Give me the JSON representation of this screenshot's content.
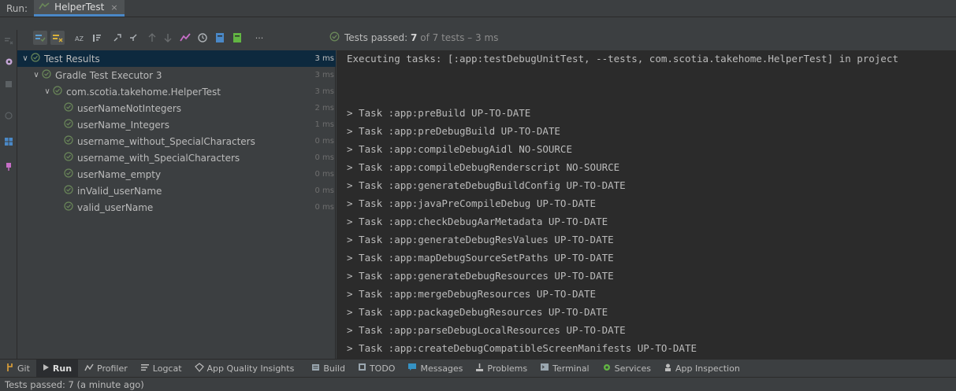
{
  "header": {
    "run_label": "Run:",
    "tab_title": "HelperTest",
    "tab_close": "×"
  },
  "toolbar": {
    "status_prefix": "Tests passed:",
    "status_count": "7",
    "status_suffix": "of 7 tests – 3 ms",
    "more": "···"
  },
  "tree": {
    "root": {
      "label": "Test Results",
      "time": "3 ms"
    },
    "executor": {
      "label": "Gradle Test Executor 3",
      "time": "3 ms"
    },
    "class": {
      "label": "com.scotia.takehome.HelperTest",
      "time": "3 ms"
    },
    "tests": [
      {
        "label": "userNameNotIntegers",
        "time": "2 ms"
      },
      {
        "label": "userName_Integers",
        "time": "1 ms"
      },
      {
        "label": "username_without_SpecialCharacters",
        "time": "0 ms"
      },
      {
        "label": "username_with_SpecialCharacters",
        "time": "0 ms"
      },
      {
        "label": "userName_empty",
        "time": "0 ms"
      },
      {
        "label": "inValid_userName",
        "time": "0 ms"
      },
      {
        "label": "valid_userName",
        "time": "0 ms"
      }
    ]
  },
  "console": {
    "lines": [
      "Executing tasks: [:app:testDebugUnitTest, --tests, com.scotia.takehome.HelperTest] in project",
      "",
      "",
      "> Task :app:preBuild UP-TO-DATE",
      "> Task :app:preDebugBuild UP-TO-DATE",
      "> Task :app:compileDebugAidl NO-SOURCE",
      "> Task :app:compileDebugRenderscript NO-SOURCE",
      "> Task :app:generateDebugBuildConfig UP-TO-DATE",
      "> Task :app:javaPreCompileDebug UP-TO-DATE",
      "> Task :app:checkDebugAarMetadata UP-TO-DATE",
      "> Task :app:generateDebugResValues UP-TO-DATE",
      "> Task :app:mapDebugSourceSetPaths UP-TO-DATE",
      "> Task :app:generateDebugResources UP-TO-DATE",
      "> Task :app:mergeDebugResources UP-TO-DATE",
      "> Task :app:packageDebugResources UP-TO-DATE",
      "> Task :app:parseDebugLocalResources UP-TO-DATE",
      "> Task :app:createDebugCompatibleScreenManifests UP-TO-DATE"
    ]
  },
  "bottom_tools": [
    {
      "label": "Git",
      "icon": "git-icon"
    },
    {
      "label": "Run",
      "icon": "run-icon"
    },
    {
      "label": "Profiler",
      "icon": "profiler-icon"
    },
    {
      "label": "Logcat",
      "icon": "logcat-icon"
    },
    {
      "label": "App Quality Insights",
      "icon": "insights-icon"
    },
    {
      "label": "Build",
      "icon": "build-icon"
    },
    {
      "label": "TODO",
      "icon": "todo-icon"
    },
    {
      "label": "Messages",
      "icon": "messages-icon"
    },
    {
      "label": "Problems",
      "icon": "problems-icon"
    },
    {
      "label": "Terminal",
      "icon": "terminal-icon"
    },
    {
      "label": "Services",
      "icon": "services-icon"
    },
    {
      "label": "App Inspection",
      "icon": "app-inspection-icon"
    }
  ],
  "status_bar": {
    "text": "Tests passed: 7 (a minute ago)"
  },
  "colors": {
    "pass_green": "#6a8759",
    "selection": "#0d293e",
    "console_bg": "#2b2b2b",
    "panel_bg": "#3c3f41",
    "accent_blue": "#4a88c7"
  }
}
